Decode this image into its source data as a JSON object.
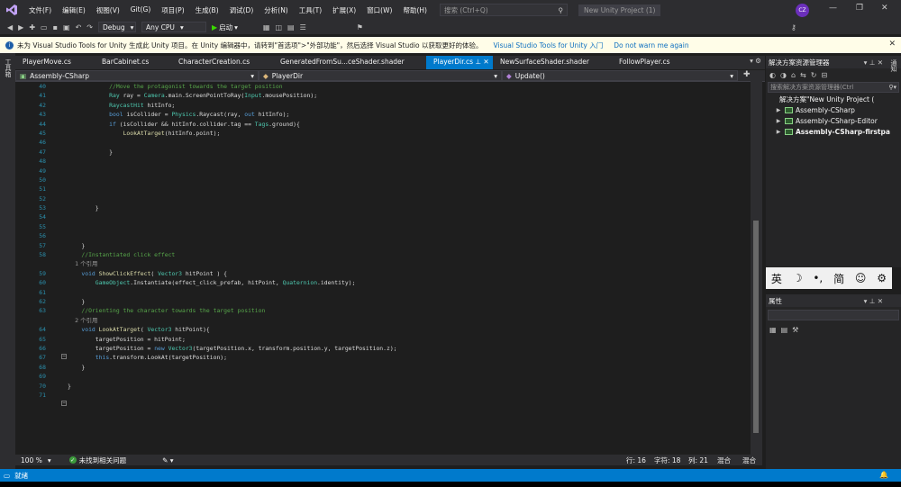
{
  "menu": [
    "文件(F)",
    "编辑(E)",
    "视图(V)",
    "Git(G)",
    "项目(P)",
    "生成(B)",
    "调试(D)",
    "分析(N)",
    "工具(T)",
    "扩展(X)",
    "窗口(W)",
    "帮助(H)"
  ],
  "search": {
    "placeholder": "搜索 (Ctrl+Q)"
  },
  "project_title": "New Unity Project (1)",
  "user_initials": "CZ",
  "toolbar": {
    "config": "Debug",
    "platform": "Any CPU",
    "start_label": "启动"
  },
  "infobar": {
    "message": "未为 Visual Studio Tools for Unity 生成此 Unity 项目。在 Unity 编辑器中，请转到\"首选项\">\"外部功能\"，然后选择 Visual Studio 以获取更好的体验。",
    "link1": "Visual Studio Tools for Unity 入门",
    "link2": "Do not warn me again"
  },
  "left_strip_label": "工具箱",
  "right_strip_label": "通知",
  "tabs": [
    {
      "label": "PlayerMove.cs",
      "active": false
    },
    {
      "label": "BarCabinet.cs",
      "active": false
    },
    {
      "label": "CharacterCreation.cs",
      "active": false
    },
    {
      "label": "GeneratedFromSu...ceShader.shader",
      "active": false
    },
    {
      "label": "PlayerDir.cs",
      "active": true
    },
    {
      "label": "NewSurfaceShader.shader",
      "active": false
    },
    {
      "label": "FollowPlayer.cs",
      "active": false
    }
  ],
  "navbar": {
    "project": "Assembly-CSharp",
    "class": "PlayerDir",
    "member": "Update()"
  },
  "code": [
    {
      "n": "40",
      "t": "            //Move the protagonist towards the target position",
      "k": "cmt"
    },
    {
      "n": "41",
      "t": "            Ray ray = Camera.main.ScreenPointToRay(Input.mousePosition);",
      "k": ""
    },
    {
      "n": "42",
      "t": "            RaycastHit hitInfo;",
      "k": ""
    },
    {
      "n": "43",
      "t": "            bool isCollider = Physics.Raycast(ray, out hitInfo);",
      "k": ""
    },
    {
      "n": "44",
      "t": "            if (isCollider && hitInfo.collider.tag == Tags.ground){",
      "k": ""
    },
    {
      "n": "45",
      "t": "                LookAtTarget(hitInfo.point);",
      "k": ""
    },
    {
      "n": "46",
      "t": "",
      "k": ""
    },
    {
      "n": "47",
      "t": "            }",
      "k": ""
    },
    {
      "n": "48",
      "t": "",
      "k": ""
    },
    {
      "n": "49",
      "t": "",
      "k": ""
    },
    {
      "n": "50",
      "t": "",
      "k": ""
    },
    {
      "n": "51",
      "t": "",
      "k": ""
    },
    {
      "n": "52",
      "t": "",
      "k": ""
    },
    {
      "n": "53",
      "t": "        }",
      "k": ""
    },
    {
      "n": "54",
      "t": "",
      "k": ""
    },
    {
      "n": "55",
      "t": "",
      "k": ""
    },
    {
      "n": "56",
      "t": "",
      "k": ""
    },
    {
      "n": "57",
      "t": "    }",
      "k": ""
    },
    {
      "n": "58",
      "t": "    //Instantiated click effect",
      "k": "cmt"
    },
    {
      "n": "",
      "t": "    1 个引用",
      "k": "ref"
    },
    {
      "n": "59",
      "t": "    void ShowClickEffect( Vector3 hitPoint ) {",
      "k": ""
    },
    {
      "n": "60",
      "t": "        GameObject.Instantiate(effect_click_prefab, hitPoint, Quaternion.identity);",
      "k": ""
    },
    {
      "n": "61",
      "t": "",
      "k": ""
    },
    {
      "n": "62",
      "t": "    }",
      "k": ""
    },
    {
      "n": "63",
      "t": "    //Orienting the character towards the target position",
      "k": "cmt"
    },
    {
      "n": "",
      "t": "    2 个引用",
      "k": "ref"
    },
    {
      "n": "64",
      "t": "    void LookAtTarget( Vector3 hitPoint){",
      "k": ""
    },
    {
      "n": "65",
      "t": "        targetPosition = hitPoint;",
      "k": ""
    },
    {
      "n": "66",
      "t": "        targetPosition = new Vector3(targetPosition.x, transform.position.y, targetPosition.z);",
      "k": ""
    },
    {
      "n": "67",
      "t": "        this.transform.LookAt(targetPosition);",
      "k": ""
    },
    {
      "n": "68",
      "t": "    }",
      "k": ""
    },
    {
      "n": "69",
      "t": "",
      "k": ""
    },
    {
      "n": "70",
      "t": "}",
      "k": ""
    },
    {
      "n": "71",
      "t": "",
      "k": ""
    }
  ],
  "editor_status": {
    "zoom": "100 %",
    "issues": "未找到相关问题",
    "line": "行: 16",
    "char": "字符: 18",
    "col": "列: 21",
    "tabs_mode1": "混合",
    "tabs_mode2": "混合"
  },
  "solution_explorer": {
    "title": "解决方案资源管理器",
    "search_placeholder": "搜索解决方案资源管理器(Ctrl",
    "items": [
      {
        "label": "解决方案\"New Unity Project (",
        "bold": false,
        "indent": 0
      },
      {
        "label": "Assembly-CSharp",
        "bold": false,
        "indent": 1
      },
      {
        "label": "Assembly-CSharp-Editor",
        "bold": false,
        "indent": 1
      },
      {
        "label": "Assembly-CSharp-firstpa",
        "bold": true,
        "indent": 1
      }
    ]
  },
  "ime": [
    "英",
    "☽",
    "•,",
    "简",
    "☺",
    "⚙"
  ],
  "properties": {
    "title": "属性"
  },
  "statusbar": {
    "text": "就绪"
  },
  "colors": {
    "accent": "#007acc",
    "bg": "#1e1e1e",
    "chrome": "#2d2d30",
    "infobar": "#fffde8"
  }
}
